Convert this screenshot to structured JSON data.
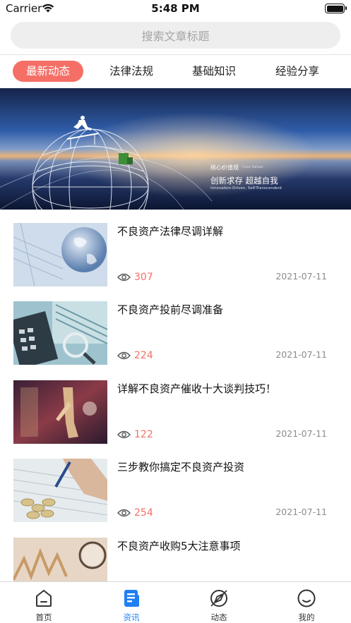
{
  "status_bar": {
    "carrier": "Carrier",
    "time": "5:48 PM",
    "icons": [
      "wifi-icon",
      "battery-icon"
    ]
  },
  "search": {
    "placeholder": "搜索文章标题"
  },
  "tabs": [
    {
      "label": "最新动态",
      "active": true
    },
    {
      "label": "法律法规",
      "active": false
    },
    {
      "label": "基础知识",
      "active": false
    },
    {
      "label": "经验分享",
      "active": false
    }
  ],
  "banner": {
    "title": "核心价值观",
    "title_en": "Core Values",
    "slogan": "创新求存  超越自我",
    "subtitle": "Innovation-Driven, Self-Transcendent"
  },
  "articles": [
    {
      "title": "不良资产法律尽调详解",
      "views": "307",
      "date": "2021-07-11",
      "image": "globe-on-documents"
    },
    {
      "title": "不良资产投前尽调准备",
      "views": "224",
      "date": "2021-07-11",
      "image": "calculator-and-banknotes"
    },
    {
      "title": "详解不良资产催收十大谈判技巧！",
      "views": "122",
      "date": "2021-07-11",
      "image": "business-handshake"
    },
    {
      "title": "三步教你搞定不良资产投资",
      "views": "254",
      "date": "2021-07-11",
      "image": "coins-and-pen-on-paper"
    },
    {
      "title": "不良资产收购5大注意事项",
      "views": "",
      "date": "",
      "image": "magnifier-on-chart"
    }
  ],
  "tabbar": [
    {
      "label": "首页",
      "icon": "home-icon",
      "active": false
    },
    {
      "label": "资讯",
      "icon": "news-icon",
      "active": true
    },
    {
      "label": "动态",
      "icon": "compass-icon",
      "active": false
    },
    {
      "label": "我的",
      "icon": "smile-icon",
      "active": false
    }
  ],
  "colors": {
    "accent": "#f56f66",
    "tab_active": "#1f7ff2"
  }
}
